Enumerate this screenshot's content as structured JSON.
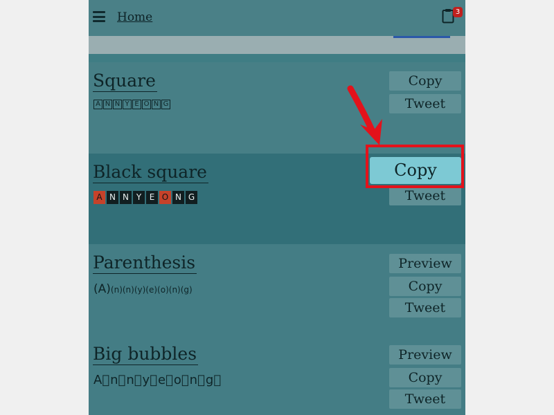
{
  "header": {
    "home_label": "Home",
    "clipboard_count": "3"
  },
  "sections": [
    {
      "title": "Square",
      "letters": [
        "A",
        "N",
        "N",
        "Y",
        "E",
        "O",
        "N",
        "G"
      ],
      "buttons": [
        "Copy",
        "Tweet"
      ]
    },
    {
      "title": "Black square",
      "letters": [
        "A",
        "N",
        "N",
        "Y",
        "E",
        "O",
        "N",
        "G"
      ],
      "red_indices": [
        0,
        5
      ],
      "buttons": [
        "Copy",
        "Tweet"
      ]
    },
    {
      "title": "Parenthesis",
      "sample_first": "(A)",
      "sample_rest": "(n)(n)(y)(e)(o)(n)(g)",
      "buttons": [
        "Preview",
        "Copy",
        "Tweet"
      ]
    },
    {
      "title": "Big bubbles",
      "sample": "A⃞n⃞n⃞y⃞e⃞o⃞n⃞g⃞",
      "buttons": [
        "Preview",
        "Copy",
        "Tweet"
      ]
    }
  ],
  "colors": {
    "highlight": "#e3121b",
    "copy_highlight_bg": "#7dc9d4",
    "red_square": "#c6422a"
  },
  "icons": {
    "menu": "hamburger-menu-icon",
    "clipboard": "clipboard-icon",
    "arrow": "red-arrow-annotation"
  }
}
